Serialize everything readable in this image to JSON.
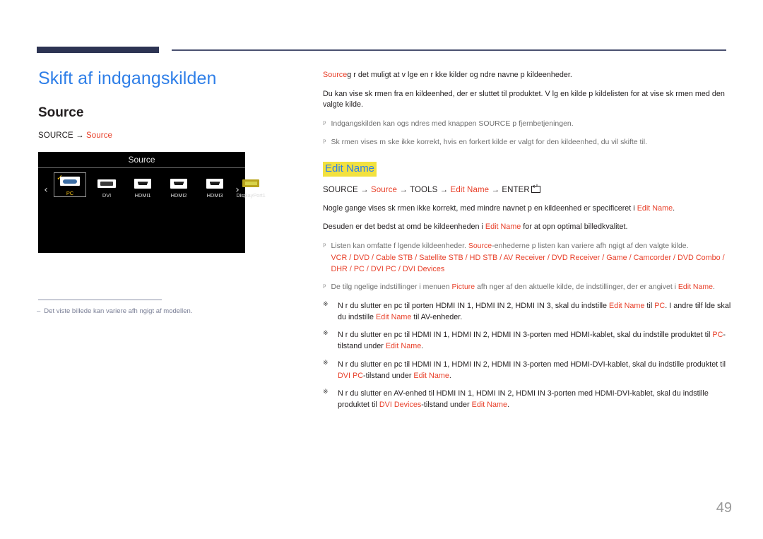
{
  "page": {
    "number": "49",
    "title": "Skift af indgangskilden",
    "section_title": "Source",
    "accent_blue": "#2f7fe8",
    "accent_red": "#e8402a",
    "highlight_yellow": "#f2e13f",
    "rule_navy": "#2d3453"
  },
  "path": {
    "source_label": "SOURCE",
    "arrow": "→",
    "target_label": "Source"
  },
  "osd": {
    "title": "Source",
    "left_arrow": "‹",
    "right_arrow": "›",
    "check_mark": "✓",
    "items": [
      {
        "label": "PC",
        "icon": "vga-port-icon",
        "selected": true
      },
      {
        "label": "DVI",
        "icon": "dvi-port-icon",
        "selected": false
      },
      {
        "label": "HDMI1",
        "icon": "hdmi-port-icon",
        "selected": false
      },
      {
        "label": "HDMI2",
        "icon": "hdmi-port-icon",
        "selected": false
      },
      {
        "label": "HDMI3",
        "icon": "hdmi-port-icon",
        "selected": false
      },
      {
        "label": "DisplayPort1",
        "icon": "displayport-icon",
        "selected": false
      }
    ]
  },
  "footnote": {
    "dash": "–",
    "text": "Det viste billede kan variere afh ngigt af modellen."
  },
  "intro": {
    "p1_red": "Source",
    "p1_rest": "g r det muligt at v lge en r kke kilder og  ndre navne p  kildeenheder.",
    "p2": "Du kan vise sk rmen fra en kildeenhed, der er sluttet til produktet. V lg en kilde p  kildelisten for at vise sk rmen med den valgte kilde.",
    "notes": [
      {
        "mark": "P",
        "text": "Indgangskilden kan ogs   ndres med knappen SOURCE p  fjernbetjeningen."
      },
      {
        "mark": "P",
        "text": "Sk rmen vises m ske ikke korrekt, hvis en forkert kilde er valgt for den kildeenhed, du vil skifte til."
      }
    ]
  },
  "edit_name": {
    "heading": "Edit Name",
    "path": {
      "p1": "SOURCE",
      "p2": "Source",
      "p3": "TOOLS",
      "p4": "Edit Name",
      "p5": "ENTER",
      "arrow": "→",
      "enter_icon": "enter-key-icon"
    },
    "p1_a": "Nogle gange vises sk rmen ikke korrekt, med mindre navnet p  en kildeenhed er specificeret i ",
    "p1_red": "Edit Name",
    "p1_b": ".",
    "p2_a": "Desuden er det bedst at omd be kildeenheden i ",
    "p2_red": "Edit Name",
    "p2_b": " for at opn  optimal billedkvalitet.",
    "note1": {
      "mark": "P",
      "a": "Listen kan omfatte f lgende kildeenheder. ",
      "red": "Source",
      "b": "-enhederne p  listen kan variere afh ngigt af den valgte kilde.",
      "devices": "VCR / DVD / Cable STB / Satellite STB / HD STB / AV Receiver / DVD Receiver / Game / Camcorder / DVD Combo / DHR / PC / DVI PC / DVI Devices"
    },
    "note2": {
      "mark": "P",
      "a": "De tilg ngelige indstillinger i menuen ",
      "red1": "Picture",
      "b": " afh nger af den aktuelle kilde, de indstillinger, der er angivet i ",
      "red2": "Edit Name",
      "c": "."
    },
    "bullets": [
      {
        "mark": "※",
        "a": "N r du slutter en pc til porten HDMI IN 1, HDMI IN 2, HDMI IN 3, skal du indstille ",
        "red1": "Edit Name",
        "b": " til ",
        "red2": "PC",
        "c": ". I andre tilf lde skal du indstille ",
        "red3": "Edit Name",
        "d": " til AV-enheder."
      },
      {
        "mark": "※",
        "a": "N r du slutter en pc til HDMI IN 1, HDMI IN 2, HDMI IN 3-porten med HDMI-kablet, skal du indstille produktet til ",
        "red1": "PC",
        "b": "-tilstand under ",
        "red2": "Edit Name",
        "c": "."
      },
      {
        "mark": "※",
        "a": "N r du slutter en pc til HDMI IN 1, HDMI IN 2, HDMI IN 3-porten med HDMI-DVI-kablet, skal du indstille produktet til ",
        "red1": "DVI",
        "b": " ",
        "red2": "PC",
        "c": "-tilstand under ",
        "red3": "Edit Name",
        "d": "."
      },
      {
        "mark": "※",
        "a": "N r du slutter en AV-enhed til HDMI IN 1, HDMI IN 2, HDMI IN 3-porten med HDMI-DVI-kablet, skal du indstille produktet til ",
        "red1": "DVI Devices",
        "b": "-tilstand under ",
        "red2": "Edit Name",
        "c": "."
      }
    ]
  }
}
